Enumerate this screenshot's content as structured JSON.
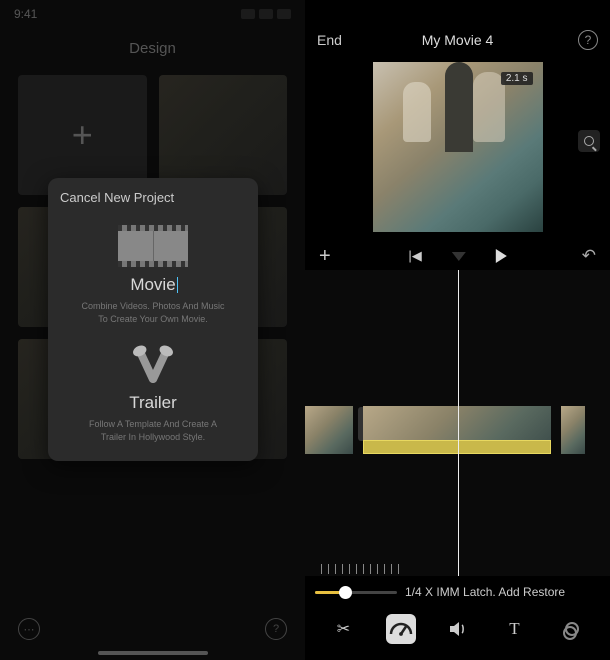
{
  "left": {
    "status_time": "9:41",
    "header": "Design",
    "modal": {
      "title": "Cancel New Project",
      "movie": {
        "label": "Movie",
        "desc_line1": "Combine Videos. Photos And Music",
        "desc_line2": "To Create Your Own Movie."
      },
      "trailer": {
        "label": "Trailer",
        "desc_line1": "Follow A Template And Create A",
        "desc_line2": "Trailer In Hollywood Style."
      }
    },
    "bottom": {
      "more": "⋯",
      "help": "?"
    }
  },
  "right": {
    "end_label": "End",
    "project_title": "My Movie 4",
    "clip_duration": "2.1 s",
    "speed_label": "1/4 X IMM Latch. Add Restore",
    "tools": {
      "cut": "✂",
      "speed": "speedometer",
      "volume": "🔊",
      "text": "T",
      "filters": "filters"
    }
  }
}
